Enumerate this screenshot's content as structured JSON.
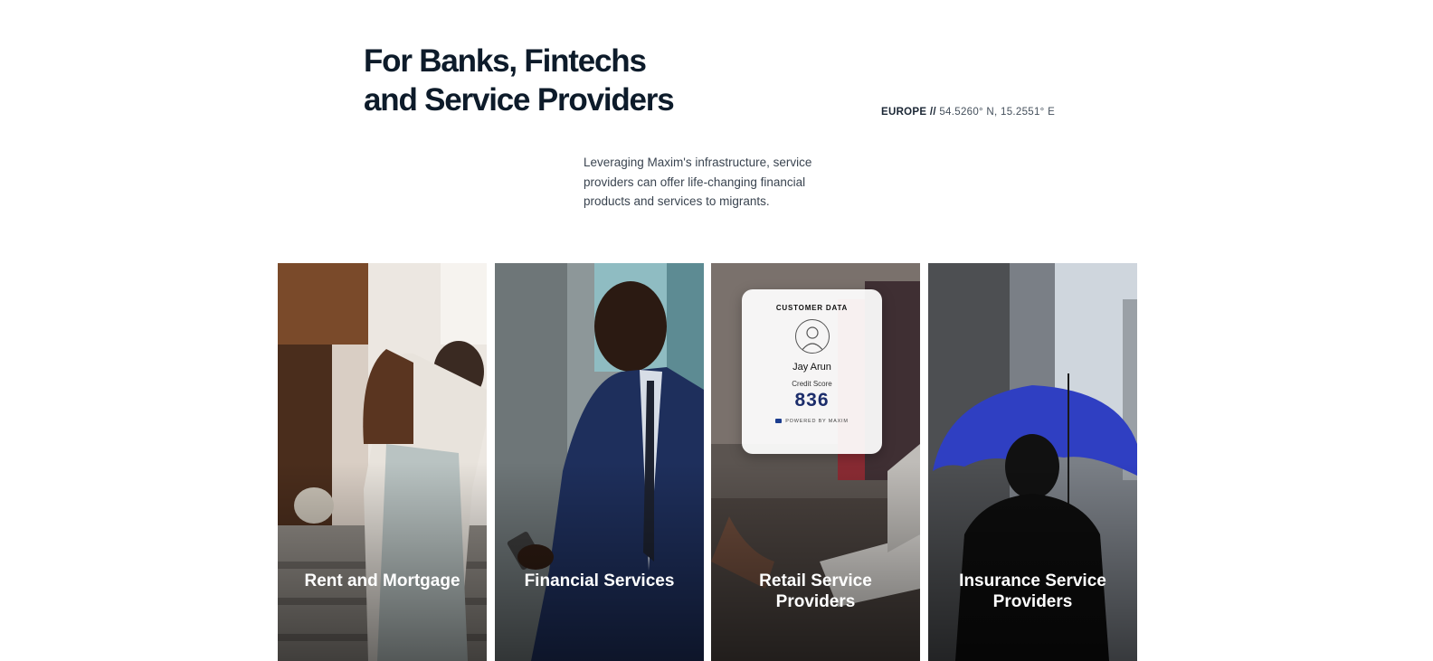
{
  "section": {
    "title_line1": "For Banks, Fintechs",
    "title_line2": "and Service Providers",
    "location_region": "EUROPE //",
    "location_coords": "54.5260° N, 15.2551° E",
    "description": "Leveraging Maxim's infrastructure, service providers can offer life-changing financial products and services to migrants."
  },
  "cards": [
    {
      "label": "Rent and Mortgage"
    },
    {
      "label": "Financial Services"
    },
    {
      "label": "Retail Service Providers"
    },
    {
      "label": "Insurance Service Providers"
    }
  ],
  "widget": {
    "title": "CUSTOMER DATA",
    "name": "Jay Arun",
    "score_label": "Credit Score",
    "score": "836",
    "powered_by": "POWERED BY MAXIM"
  },
  "colors": {
    "heading": "#0d1b2a",
    "score": "#1c2d6b",
    "umbrella": "#2f3fc2"
  }
}
